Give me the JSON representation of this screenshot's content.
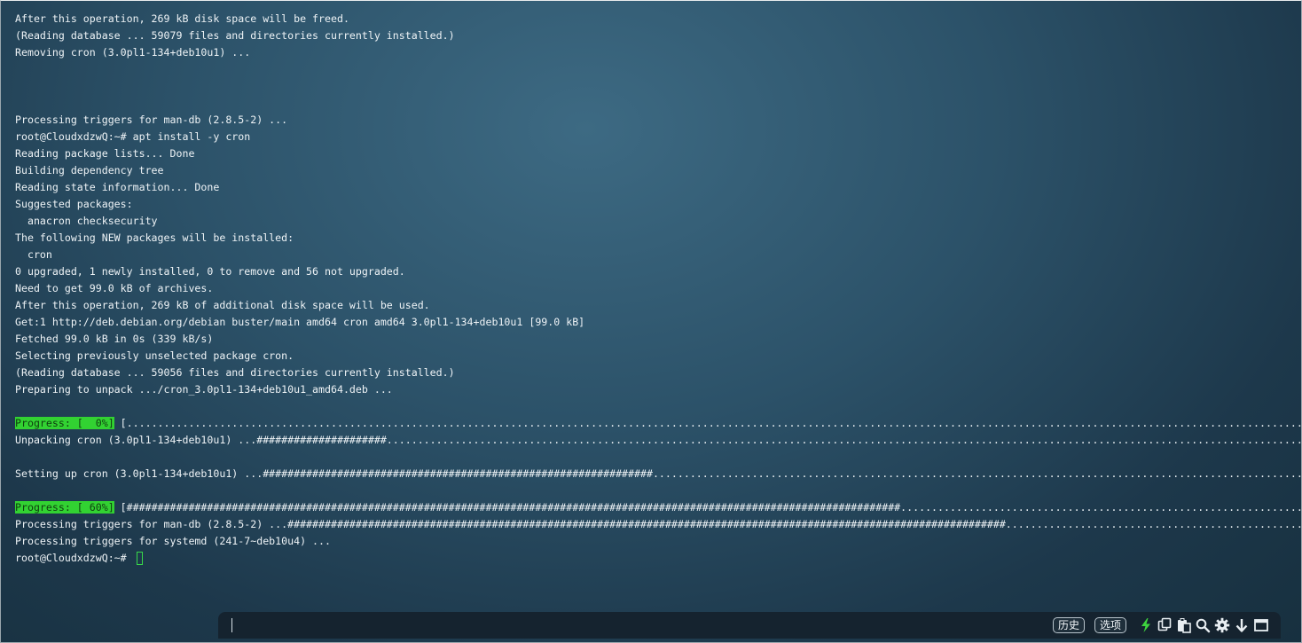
{
  "terminal": {
    "lines": [
      {
        "text": "After this operation, 269 kB disk space will be freed."
      },
      {
        "text": "(Reading database ... 59079 files and directories currently installed.)"
      },
      {
        "text": "Removing cron (3.0pl1-134+deb10u1) ..."
      },
      {
        "text": ""
      },
      {
        "text": ""
      },
      {
        "text": ""
      },
      {
        "text": "Processing triggers for man-db (2.8.5-2) ..."
      },
      {
        "text": "root@CloudxdzwQ:~# apt install -y cron"
      },
      {
        "text": "Reading package lists... Done"
      },
      {
        "text": "Building dependency tree"
      },
      {
        "text": "Reading state information... Done"
      },
      {
        "text": "Suggested packages:"
      },
      {
        "text": "  anacron checksecurity"
      },
      {
        "text": "The following NEW packages will be installed:"
      },
      {
        "text": "  cron"
      },
      {
        "text": "0 upgraded, 1 newly installed, 0 to remove and 56 not upgraded."
      },
      {
        "text": "Need to get 99.0 kB of archives."
      },
      {
        "text": "After this operation, 269 kB of additional disk space will be used."
      },
      {
        "text": "Get:1 http://deb.debian.org/debian buster/main amd64 cron amd64 3.0pl1-134+deb10u1 [99.0 kB]"
      },
      {
        "text": "Fetched 99.0 kB in 0s (339 kB/s)"
      },
      {
        "text": "Selecting previously unselected package cron."
      },
      {
        "text": "(Reading database ... 59056 files and directories currently installed.)"
      },
      {
        "text": "Preparing to unpack .../cron_3.0pl1-134+deb10u1_amd64.deb ..."
      },
      {
        "text": ""
      },
      {
        "prefix": "Progress: [  0%]",
        "text": " [.......................................................................................................................................................................................................................................................]"
      },
      {
        "text": "Unpacking cron (3.0pl1-134+deb10u1) ...#####################..................................................................................................................................................................................................."
      },
      {
        "text": ""
      },
      {
        "text": "Setting up cron (3.0pl1-134+deb10u1) ...###############################################################......................................................................................................................................................."
      },
      {
        "text": ""
      },
      {
        "prefix": "Progress: [ 60%]",
        "text": " [#############################################################################################################################.................................................................................................................."
      },
      {
        "text": "Processing triggers for man-db (2.8.5-2) ...####################################################################################################################.........................................................................................."
      },
      {
        "text": "Processing triggers for systemd (241-7~deb10u4) ..."
      },
      {
        "text": "root@CloudxdzwQ:~# ",
        "cursor": true
      }
    ]
  },
  "command_bar": {
    "input_value": "",
    "history_label": "历史",
    "options_label": "选项",
    "icons": [
      "lightning-icon",
      "copy-icon",
      "paste-icon",
      "search-icon",
      "gear-icon",
      "arrow-down-icon",
      "window-icon"
    ]
  },
  "colors": {
    "progress_bg": "#32d232",
    "cursor": "#37d84a",
    "lightning": "#3ed43e"
  }
}
